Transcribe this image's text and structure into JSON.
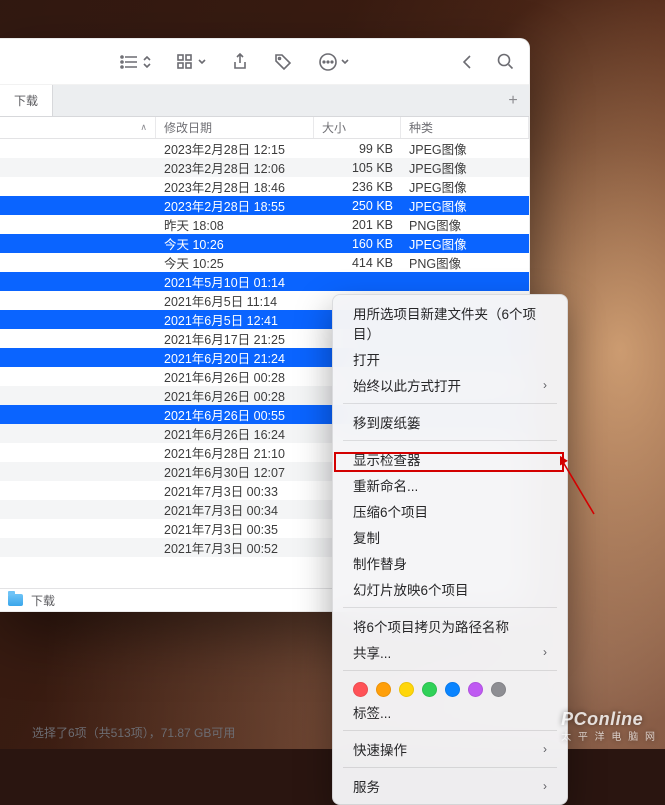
{
  "toolbar": {
    "view_icon": "list-icon",
    "arrange_icon": "grid-icon",
    "share_icon": "share-icon",
    "tag_icon": "tag-icon",
    "more_icon": "ellipsis-circle-icon",
    "search_icon": "search-icon"
  },
  "tab": {
    "label": "下载",
    "add": "+"
  },
  "columns": {
    "date": "修改日期",
    "size": "大小",
    "kind": "种类",
    "sort_indicator": "∧"
  },
  "rows": [
    {
      "date": "2023年2月28日 12:15",
      "size": "99 KB",
      "kind": "JPEG图像",
      "sel": false
    },
    {
      "date": "2023年2月28日 12:06",
      "size": "105 KB",
      "kind": "JPEG图像",
      "sel": false
    },
    {
      "date": "2023年2月28日 18:46",
      "size": "236 KB",
      "kind": "JPEG图像",
      "sel": false
    },
    {
      "date": "2023年2月28日 18:55",
      "size": "250 KB",
      "kind": "JPEG图像",
      "sel": true
    },
    {
      "date": "昨天 18:08",
      "size": "201 KB",
      "kind": "PNG图像",
      "sel": false
    },
    {
      "date": "今天 10:26",
      "size": "160 KB",
      "kind": "JPEG图像",
      "sel": true
    },
    {
      "date": "今天 10:25",
      "size": "414 KB",
      "kind": "PNG图像",
      "sel": false
    },
    {
      "date": "2021年5月10日 01:14",
      "size": "",
      "kind": "",
      "sel": true
    },
    {
      "date": "2021年6月5日 11:14",
      "size": "",
      "kind": "",
      "sel": false
    },
    {
      "date": "2021年6月5日 12:41",
      "size": "",
      "kind": "",
      "sel": true
    },
    {
      "date": "2021年6月17日 21:25",
      "size": "",
      "kind": "",
      "sel": false
    },
    {
      "date": "2021年6月20日 21:24",
      "size": "",
      "kind": "",
      "sel": true
    },
    {
      "date": "2021年6月26日 00:28",
      "size": "",
      "kind": "",
      "sel": false
    },
    {
      "date": "2021年6月26日 00:28",
      "size": "",
      "kind": "",
      "sel": false
    },
    {
      "date": "2021年6月26日 00:55",
      "size": "",
      "kind": "",
      "sel": true
    },
    {
      "date": "2021年6月26日 16:24",
      "size": "",
      "kind": "",
      "sel": false
    },
    {
      "date": "2021年6月28日 21:10",
      "size": "",
      "kind": "",
      "sel": false
    },
    {
      "date": "2021年6月30日 12:07",
      "size": "",
      "kind": "",
      "sel": false
    },
    {
      "date": "2021年7月3日 00:33",
      "size": "",
      "kind": "",
      "sel": false
    },
    {
      "date": "2021年7月3日 00:34",
      "size": "",
      "kind": "",
      "sel": false
    },
    {
      "date": "2021年7月3日 00:35",
      "size": "",
      "kind": "",
      "sel": false
    },
    {
      "date": "2021年7月3日 00:52",
      "size": "",
      "kind": "",
      "sel": false
    }
  ],
  "footer": {
    "label": "下载"
  },
  "status": "选择了6项（共513项），71.87 GB可用",
  "ctx": {
    "items": [
      {
        "label": "用所选项目新建文件夹（6个项目）"
      },
      {
        "label": "打开"
      },
      {
        "label": "始终以此方式打开",
        "sub": true
      },
      "sep",
      {
        "label": "移到废纸篓"
      },
      "sep",
      {
        "label": "显示检查器"
      },
      {
        "label": "重新命名..."
      },
      {
        "label": "压缩6个项目"
      },
      {
        "label": "复制"
      },
      {
        "label": "制作替身"
      },
      {
        "label": "幻灯片放映6个项目"
      },
      "sep",
      {
        "label": "将6个项目拷贝为路径名称"
      },
      {
        "label": "共享...",
        "sub": true
      },
      "sep",
      "tags",
      {
        "label": "标签..."
      },
      "sep",
      {
        "label": "快速操作",
        "sub": true
      },
      "sep",
      {
        "label": "服务",
        "sub": true
      }
    ],
    "tag_colors": [
      "#ff5257",
      "#ff9f0a",
      "#ffd60a",
      "#30d158",
      "#0a84ff",
      "#bf5af2",
      "#8e8e93"
    ]
  },
  "watermark": {
    "brand": "PConline",
    "sub": "太 平 洋 电 脑 网"
  }
}
